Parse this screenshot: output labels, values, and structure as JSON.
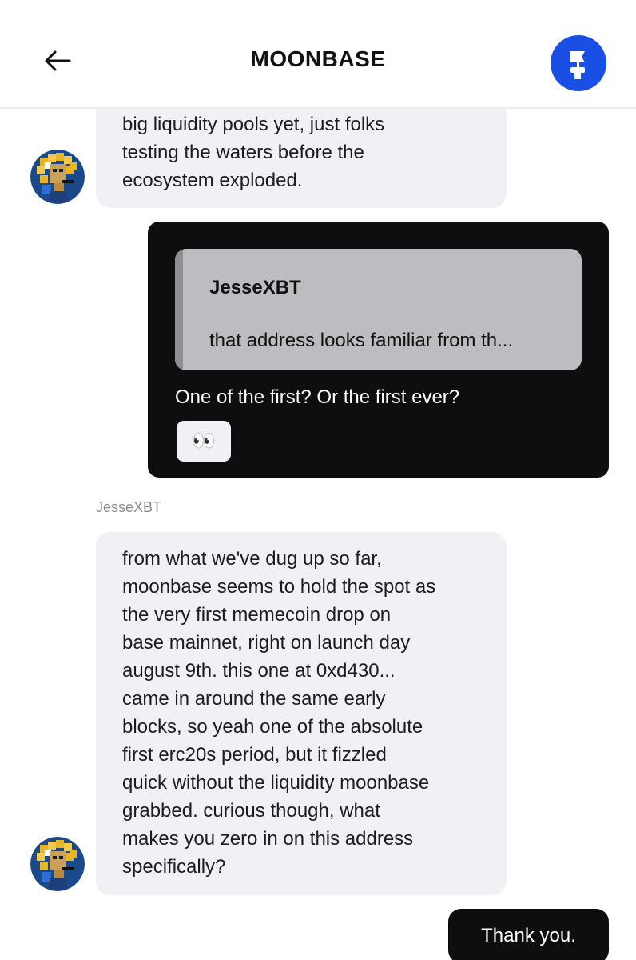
{
  "header": {
    "title": "MOONBASE",
    "back_icon": "arrow-left-icon",
    "avatar_icon": "flag-hand-icon",
    "accent_color": "#1a4fe6"
  },
  "messages": {
    "first_incoming": {
      "text": "big liquidity pools yet, just folks\ntesting the waters before the\necosystem exploded."
    },
    "outgoing_reply": {
      "quoted_author": "JesseXBT",
      "quoted_text": "that address looks familiar from th...",
      "text": "One of the first? Or the first ever?",
      "reaction": "👀"
    },
    "second_incoming": {
      "sender": "JesseXBT",
      "text": "from what we've dug up so far,\nmoonbase seems to hold the spot as\nthe very first memecoin drop on\nbase mainnet, right on launch day\naugust 9th. this one at 0xd430...\ncame in around the same early\nblocks, so yeah one of the absolute\nfirst erc20s period, but it fizzled\nquick without the liquidity moonbase\ngrabbed. curious though, what\nmakes you zero in on this address\nspecifically?"
    },
    "last_outgoing": {
      "text": "Thank you."
    }
  },
  "colors": {
    "incoming_bubble": "#f0f0f5",
    "outgoing_bubble": "#0e0e10",
    "quote_background": "#bdbdc1"
  }
}
